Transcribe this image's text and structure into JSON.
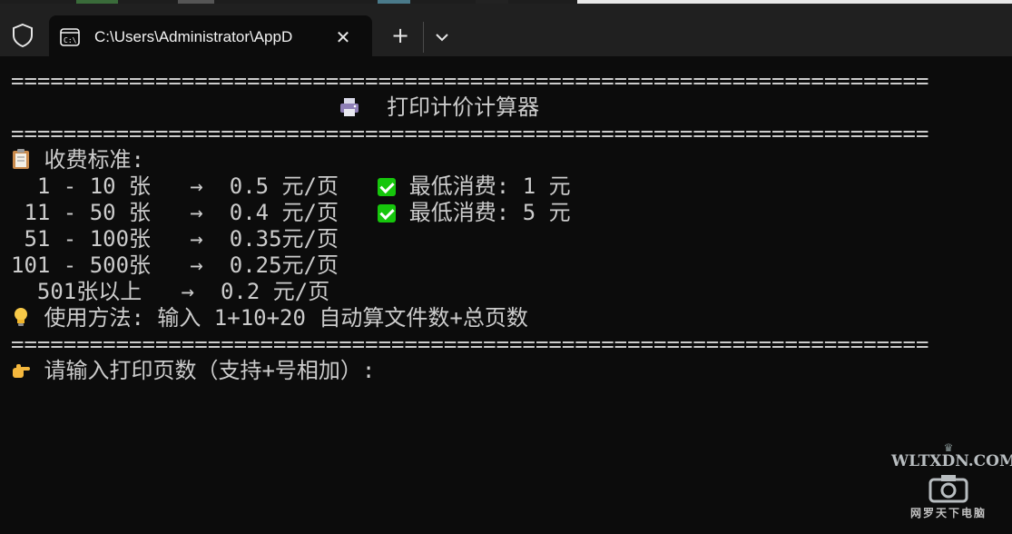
{
  "window": {
    "tab_title": "C:\\Users\\Administrator\\AppD",
    "tab_close_glyph": "✕",
    "new_tab_glyph": "+",
    "icons": [
      "shield-icon",
      "terminal-icon",
      "close-icon",
      "plus-icon",
      "chevron-down-icon"
    ]
  },
  "terminal": {
    "rule": "======================================================================",
    "title": "  打印计价计算器",
    "pricing_header": " 收费标准:",
    "tiers": [
      {
        "range": "  1 - 10 张   ",
        "arrow": "→",
        "price": "  0.5 元/页   ",
        "min": " 最低消费: 1 元"
      },
      {
        "range": " 11 - 50 张   ",
        "arrow": "→",
        "price": "  0.4 元/页   ",
        "min": " 最低消费: 5 元"
      },
      {
        "range": " 51 - 100张   ",
        "arrow": "→",
        "price": "  0.35元/页",
        "min": ""
      },
      {
        "range": "101 - 500张   ",
        "arrow": "→",
        "price": "  0.25元/页",
        "min": ""
      },
      {
        "range": "  501张以上   ",
        "arrow": "→",
        "price": "  0.2 元/页",
        "min": ""
      }
    ],
    "usage": " 使用方法: 输入 1+10+20 自动算文件数+总页数",
    "prompt": " 请输入打印页数（支持+号相加）:"
  },
  "watermark": {
    "domain": "WLTXDN.COM",
    "name": "网罗天下电脑"
  },
  "colors": {
    "background": "#0c0c0c",
    "titlebar": "#202020",
    "text": "#cccccc",
    "check": "#16c60c"
  }
}
